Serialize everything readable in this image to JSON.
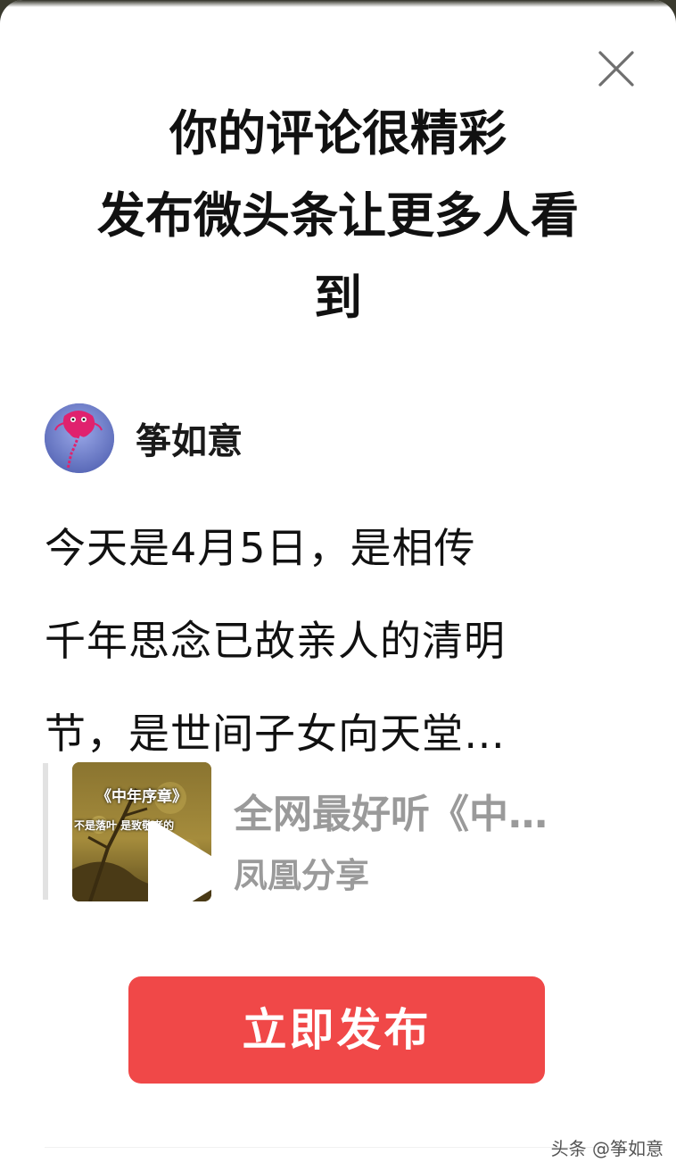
{
  "dialog": {
    "headline_lines": [
      "你的评论很精彩",
      "发布微头条让更多人看",
      "到"
    ],
    "close_icon": "close-icon"
  },
  "author": {
    "name": "筝如意",
    "avatar_icon": "kite-avatar"
  },
  "post": {
    "lines": [
      "今天是4月5日，是相传",
      "千年思念已故亲人的清明",
      "节，是世间子女向天堂…"
    ]
  },
  "video": {
    "thumb_title": "《中年序章》",
    "thumb_subtitle": "不是落叶 是致敬者的",
    "title": "全网最好听《中…",
    "source": "凤凰分享",
    "play_icon": "play-icon"
  },
  "publish_button": {
    "label": "立即发布"
  },
  "watermark": "头条 @筝如意",
  "colors": {
    "accent": "#f04848",
    "muted_text": "#9a9a9a",
    "text": "#111111"
  }
}
